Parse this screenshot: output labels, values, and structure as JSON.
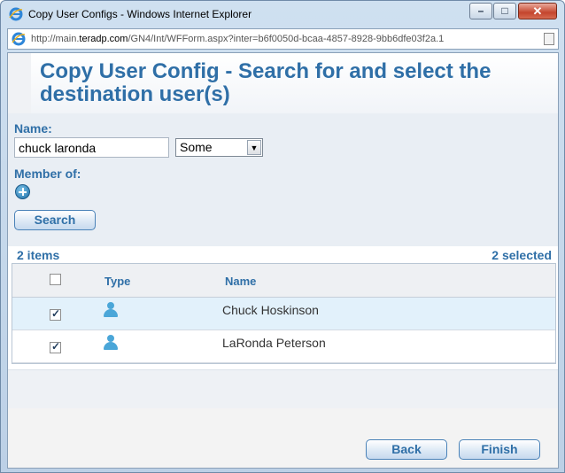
{
  "window": {
    "title": "Copy User Configs - Windows Internet Explorer",
    "controls": {
      "minimize": "–",
      "maximize": "□",
      "close": "✕"
    }
  },
  "address": {
    "prefix": "http://main.",
    "host": "teradp.com",
    "path": "/GN4/Int/WFForm.aspx?inter=b6f0050d-bcaa-4857-8928-9bb6dfe03f2a.1"
  },
  "page": {
    "title": "Copy User Config - Search for and select the destination user(s)"
  },
  "form": {
    "name_label": "Name:",
    "name_value": "chuck laronda",
    "match_select_value": "Some",
    "member_of_label": "Member of:",
    "search_button": "Search"
  },
  "results": {
    "count_label": "2 items",
    "selected_label": "2 selected",
    "columns": {
      "type": "Type",
      "name": "Name"
    },
    "rows": [
      {
        "name": "Chuck Hoskinson",
        "checked": true,
        "type_icon": "user-icon"
      },
      {
        "name": "LaRonda Peterson",
        "checked": true,
        "type_icon": "user-icon"
      }
    ]
  },
  "footer": {
    "back_button": "Back",
    "finish_button": "Finish"
  },
  "colors": {
    "accent": "#2f6fa7",
    "selected_row": "#e2f1fb",
    "user_icon": "#4aa6d8"
  }
}
